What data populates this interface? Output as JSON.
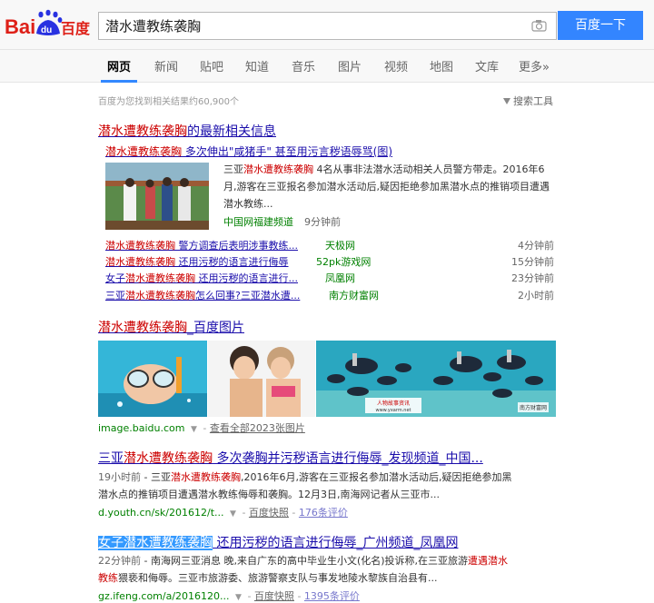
{
  "logo": {
    "text_bai": "Bai",
    "text_du": "du",
    "text_cn": "百度",
    "colors": {
      "red": "#de2018",
      "blue": "#2932e1"
    }
  },
  "search": {
    "query": "潜水遭教练袭胸",
    "button_label": "百度一下",
    "camera_icon": "camera-icon"
  },
  "nav": {
    "items": [
      "网页",
      "新闻",
      "贴吧",
      "知道",
      "音乐",
      "图片",
      "视频",
      "地图",
      "文库",
      "更多»"
    ],
    "active": "网页"
  },
  "result_count": "百度为您找到相关结果约60,900个",
  "tools_label": "搜索工具",
  "news_block": {
    "title_em": "潜水遭教练袭胸",
    "title_rest": "的最新相关信息",
    "featured": {
      "link_em": "潜水遭教练袭胸",
      "link_rest": " 多次伸出\"咸猪手\" 甚至用污言秽语辱骂(图)",
      "abstract_pre": "三亚",
      "abstract_em": "潜水遭教练袭胸",
      "abstract_post": " 4名从事非法潜水活动相关人员警方带走。2016年6月,游客在三亚报名参加潜水活动后,疑因拒绝参加黑潜水点的推销项目遭遇潜水教练...",
      "source": "中国网福建频道",
      "time": "9分钟前"
    },
    "items": [
      {
        "em": "潜水遭教练袭胸",
        "rest": " 警方调查后表明涉事教练...",
        "source": "天极网",
        "time": "4分钟前"
      },
      {
        "em": "潜水遭教练袭胸",
        "rest": " 还用污秽的语言进行侮辱",
        "source": "52pk游戏网",
        "time": "15分钟前"
      },
      {
        "pre": "女子",
        "em": "潜水遭教练袭胸",
        "rest": " 还用污秽的语言进行...",
        "source": "凤凰网",
        "time": "23分钟前"
      },
      {
        "pre": "三亚",
        "em": "潜水遭教练袭胸",
        "rest": "怎么回事?三亚潜水遭...",
        "source": "南方财富网",
        "time": "2小时前"
      }
    ]
  },
  "image_block": {
    "title_em": "潜水遭教练袭胸",
    "title_rest": "_百度图片",
    "domain": "image.baidu.com",
    "more_label": "查看全部2023张图片",
    "watermark_1": "人物故事资讯",
    "watermark_1b": "www.yxarm.net",
    "watermark_2": "南方财富网"
  },
  "results": [
    {
      "title_pre": "三亚",
      "title_em": "潜水遭教练袭胸",
      "title_rest": " 多次袭胸并污秽语言进行侮辱_发现频道_中国...",
      "time": "19小时前",
      "abs_pre": " - 三亚",
      "abs_em": "潜水遭教练袭胸",
      "abs_post1": ",2016年6月,游客在三亚报名参加潜水活动后,疑因拒绝参加黑",
      "abs_post2": "潜水点的推销项目遭遇潜水教练侮辱和袭胸。12月3日,南海网记者从三亚市...",
      "url": "d.youth.cn/sk/201612/t...",
      "snapshot": "百度快照",
      "reviews": "176条评价"
    },
    {
      "title_hl": "女子潜水遭教练袭胸",
      "title_rest": " 还用污秽的语言进行侮辱_广州频道_凤凰网",
      "time": "22分钟前",
      "abs1_pre": " - 南海网三亚消息 晚,来自广东的高中毕业生小文(化名)投诉称,在三亚旅游",
      "abs1_em": "遭遇潜水",
      "abs2_em": "教练",
      "abs2_post": "猥亵和侮辱。三亚市旅游委、旅游警察支队与事发地陵水黎族自治县有...",
      "url": "gz.ifeng.com/a/2016120...",
      "snapshot": "百度快照",
      "reviews": "1395条评价"
    }
  ]
}
